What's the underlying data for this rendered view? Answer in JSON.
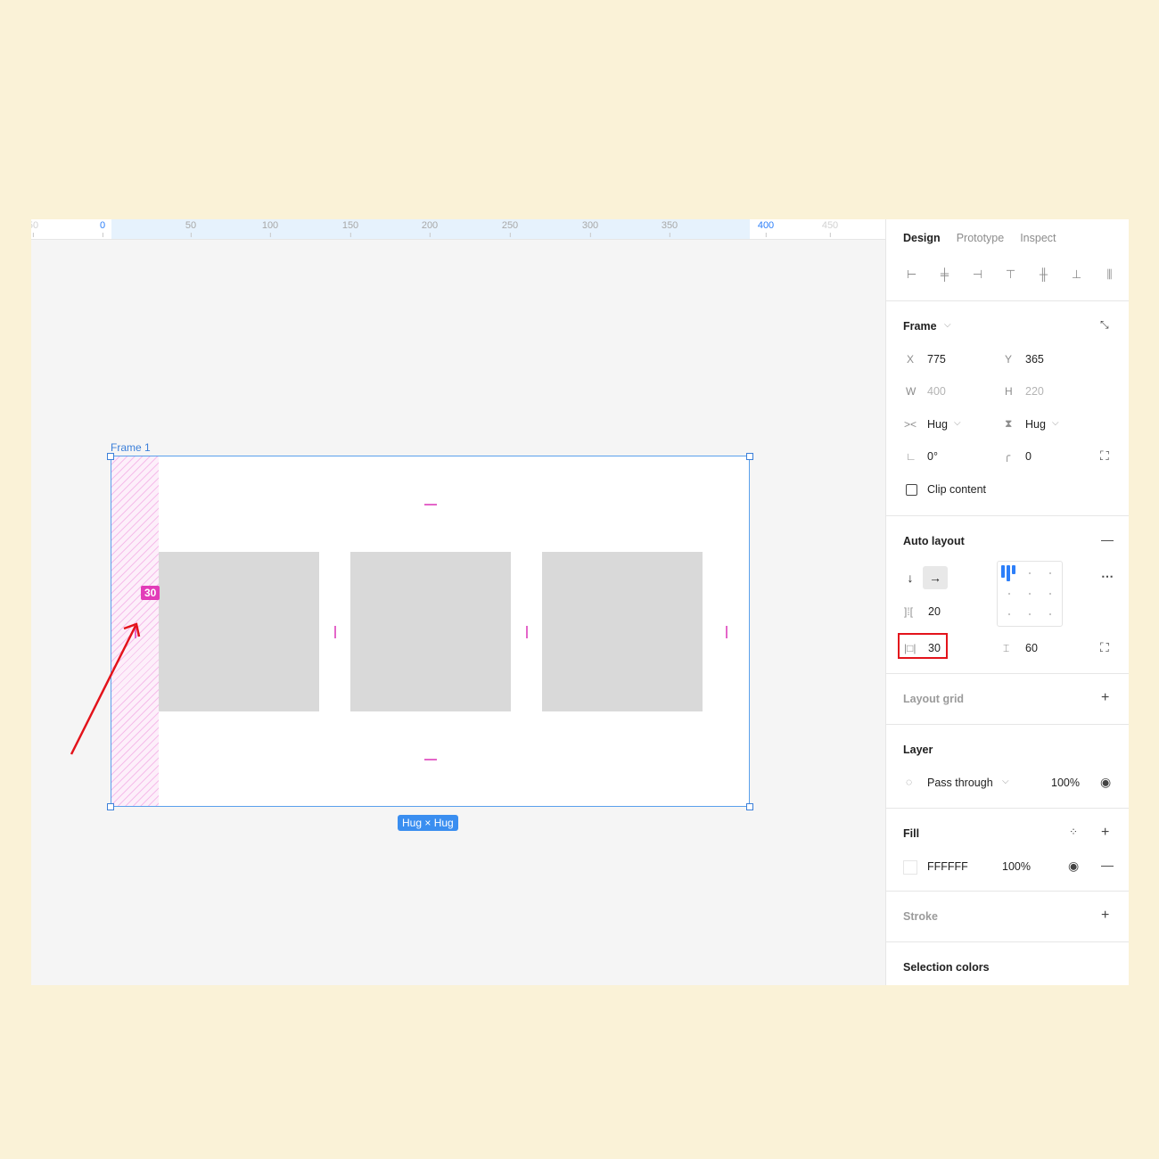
{
  "ruler": {
    "ticks": [
      "50",
      "0",
      "50",
      "100",
      "150",
      "200",
      "250",
      "300",
      "350",
      "400",
      "450"
    ],
    "sel_start": "0",
    "sel_end": "400"
  },
  "canvas": {
    "frame_name": "Frame 1",
    "padding_badge": "30",
    "size_badge": "Hug × Hug",
    "colors": {
      "selection": "#5aa0ec",
      "padding": "#e466c9",
      "annotation_arrow": "#e3131b"
    }
  },
  "panel": {
    "tabs": [
      "Design",
      "Prototype",
      "Inspect"
    ],
    "align_icons": [
      "align-left-icon",
      "align-horizontal-center-icon",
      "align-right-icon",
      "align-top-icon",
      "align-vertical-center-icon",
      "align-bottom-icon",
      "distribute-icon"
    ],
    "frame": {
      "title": "Frame",
      "x_label": "X",
      "x": "775",
      "y_label": "Y",
      "y": "365",
      "w_label": "W",
      "w": "400",
      "h_label": "H",
      "h": "220",
      "hug_w": "Hug",
      "hug_h": "Hug",
      "rotation": "0°",
      "radius": "0",
      "clip_content": "Clip content"
    },
    "auto_layout": {
      "title": "Auto layout",
      "direction": "horizontal",
      "spacing": "20",
      "horizontal_padding": "30",
      "vertical_padding": "60"
    },
    "layout_grid": {
      "title": "Layout grid"
    },
    "layer": {
      "title": "Layer",
      "blend": "Pass through",
      "opacity": "100%"
    },
    "fill": {
      "title": "Fill",
      "color": "FFFFFF",
      "opacity": "100%"
    },
    "stroke": {
      "title": "Stroke"
    },
    "selection_colors": {
      "title": "Selection colors"
    }
  }
}
